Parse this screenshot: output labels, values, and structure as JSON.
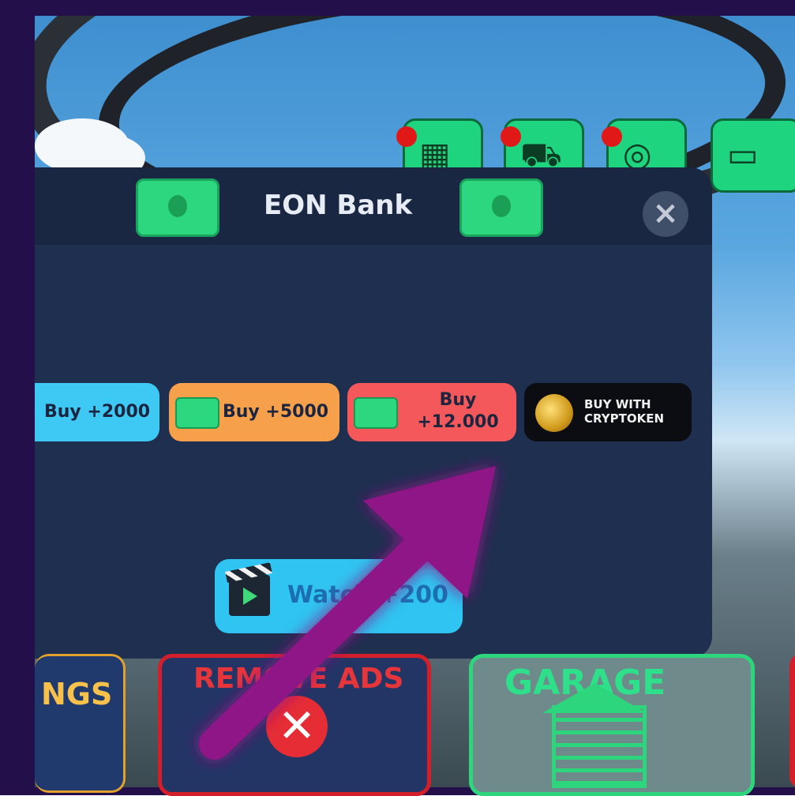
{
  "bank": {
    "title": "EON Bank",
    "close_label": "×"
  },
  "offers": [
    {
      "label": "Buy +2000"
    },
    {
      "label": "Buy +5000"
    },
    {
      "label": "Buy +12.000"
    },
    {
      "label": "BUY WITH CRYPTOKEN"
    }
  ],
  "watch": {
    "label": "Watch +200"
  },
  "cards": {
    "settings_fragment": "NGS",
    "remove_ads": "REMOVE ADS",
    "garage": "GARAGE"
  },
  "colors": {
    "frame": "#23104a",
    "panel": "#1e2f4f",
    "cash_green": "#2cd77f",
    "buy_blue": "#3ec8f4",
    "buy_orange": "#f7a04c",
    "buy_red": "#f5585a",
    "crypto_black": "#0b0d12",
    "arrow_magenta": "#9b1a8a"
  },
  "icons": [
    "calendar-icon",
    "car-icon",
    "steering-wheel-icon",
    "cash-icon",
    "coin-icon",
    "clapperboard-icon",
    "close-icon",
    "garage-icon"
  ]
}
